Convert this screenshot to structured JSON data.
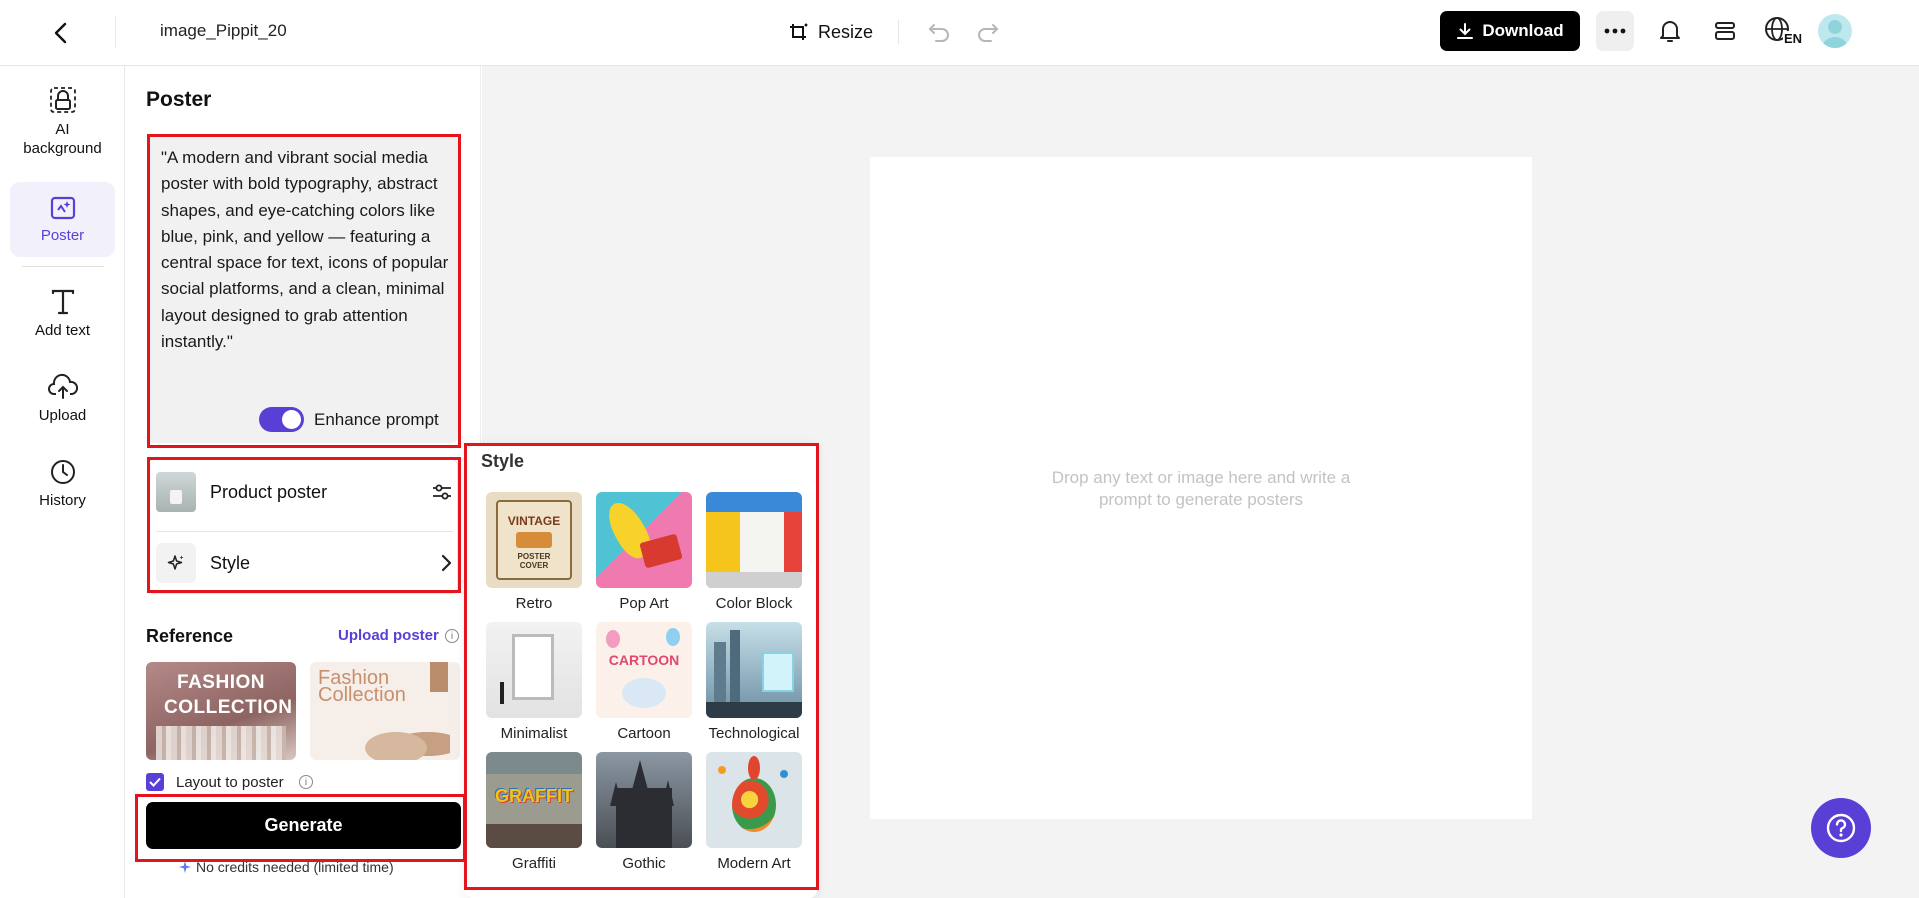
{
  "header": {
    "filename": "image_Pippit_20",
    "resize_label": "Resize",
    "download_label": "Download",
    "lang_code": "EN"
  },
  "nav": {
    "items": [
      {
        "label": "AI background",
        "icon": "ai-background-icon"
      },
      {
        "label": "Poster",
        "icon": "poster-icon",
        "active": true
      },
      {
        "label": "Add text",
        "icon": "text-icon"
      },
      {
        "label": "Upload",
        "icon": "upload-cloud-icon"
      },
      {
        "label": "History",
        "icon": "clock-icon"
      }
    ]
  },
  "panel": {
    "title": "Poster",
    "prompt": "\"A modern and vibrant social media poster with bold typography, abstract shapes, and eye-catching colors like blue, pink, and yellow — featuring a central space for text, icons of popular social platforms, and a clean, minimal layout designed to grab attention instantly.\"",
    "enhance_label": "Enhance prompt",
    "enhance_on": true,
    "poster_type": "Product poster",
    "style_label": "Style",
    "reference_label": "Reference",
    "upload_poster_label": "Upload poster",
    "ref1_text": "FASHION COLLECTION",
    "ref2_text": "Fashion Collection",
    "layout_label": "Layout to poster",
    "layout_checked": true,
    "generate_label": "Generate",
    "credits_note": "No credits needed (limited time)"
  },
  "style_popup": {
    "title": "Style",
    "styles": [
      "Retro",
      "Pop Art",
      "Color Block",
      "Minimalist",
      "Cartoon",
      "Technological",
      "Graffiti",
      "Gothic",
      "Modern Art"
    ],
    "retro_text_1": "VINTAGE",
    "retro_text_2": "POSTER COVER",
    "cartoon_text": "CARTOON",
    "graffiti_text": "GRAFFIT"
  },
  "canvas": {
    "drop_text": "Drop any text or image here and write a prompt to generate posters"
  },
  "colors": {
    "accent": "#5a3fd6",
    "highlight_frame": "#e3141b",
    "button_dark": "#000000",
    "canvas_bg": "#f3f3f3"
  }
}
